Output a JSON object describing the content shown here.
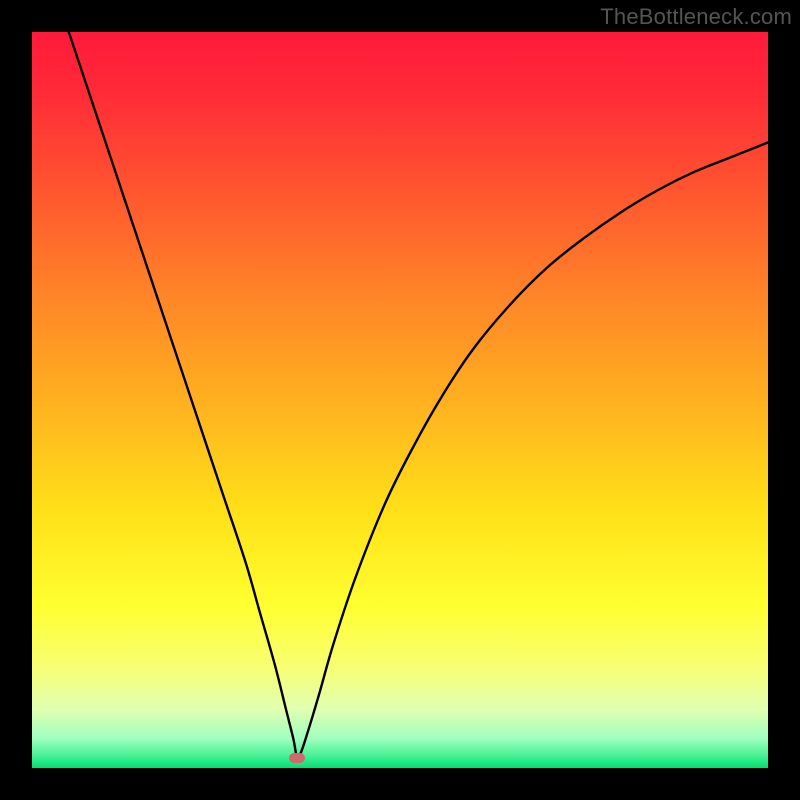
{
  "watermark": "TheBottleneck.com",
  "chart_data": {
    "type": "line",
    "title": "",
    "xlabel": "",
    "ylabel": "",
    "xlim": [
      0,
      100
    ],
    "ylim": [
      0,
      100
    ],
    "grid": false,
    "background_gradient": {
      "stops": [
        {
          "offset": 0.0,
          "color": "#ff1a3a"
        },
        {
          "offset": 0.08,
          "color": "#ff2a38"
        },
        {
          "offset": 0.2,
          "color": "#ff5030"
        },
        {
          "offset": 0.35,
          "color": "#ff8228"
        },
        {
          "offset": 0.5,
          "color": "#ffb020"
        },
        {
          "offset": 0.65,
          "color": "#ffe018"
        },
        {
          "offset": 0.78,
          "color": "#ffff30"
        },
        {
          "offset": 0.86,
          "color": "#f8ff70"
        },
        {
          "offset": 0.92,
          "color": "#e0ffb0"
        },
        {
          "offset": 0.96,
          "color": "#a0ffc0"
        },
        {
          "offset": 0.985,
          "color": "#40f090"
        },
        {
          "offset": 1.0,
          "color": "#00e070"
        }
      ]
    },
    "series": [
      {
        "name": "bottleneck-curve",
        "color": "#000000",
        "width": 2.4,
        "x": [
          5,
          8,
          11,
          14,
          17,
          20,
          23,
          26,
          29,
          31,
          33,
          34.5,
          35.5,
          36,
          36.5,
          37.5,
          39,
          41,
          44,
          48,
          52,
          56,
          60,
          65,
          70,
          75,
          80,
          85,
          90,
          95,
          100
        ],
        "y": [
          100,
          91,
          82,
          73,
          64,
          55,
          46,
          37,
          28,
          21,
          14,
          8,
          4,
          1.5,
          2,
          5,
          10,
          17,
          26,
          36,
          44,
          51,
          57,
          63,
          68,
          72,
          75.5,
          78.5,
          81,
          83,
          85
        ]
      }
    ],
    "marker": {
      "name": "optimal-point",
      "x": 36,
      "y": 1.3,
      "color": "#cf6a6a"
    }
  }
}
